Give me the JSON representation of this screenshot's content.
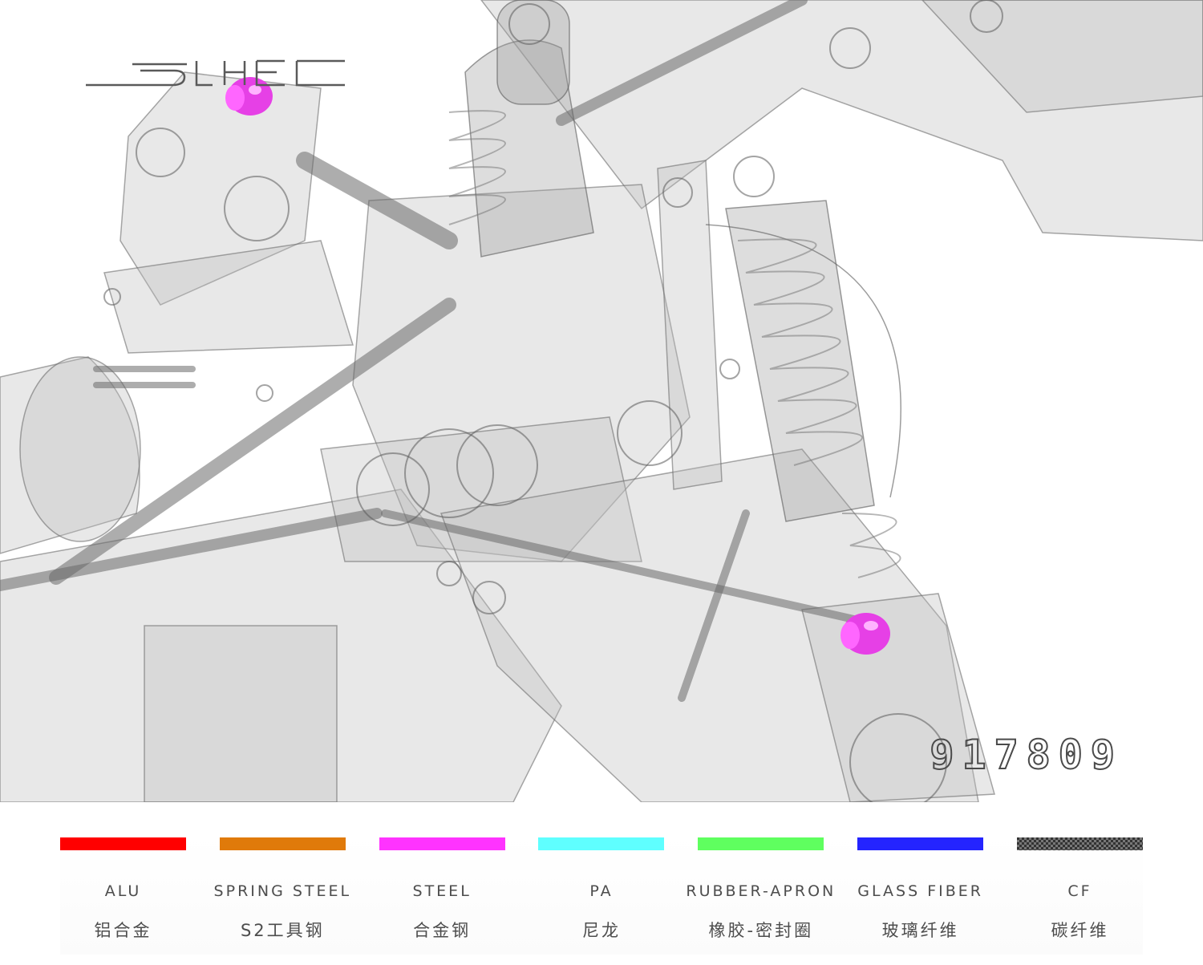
{
  "render": {
    "part_number": "917809",
    "highlight_color": "#ff33ff"
  },
  "legend": {
    "items": [
      {
        "en": "ALU",
        "zh": "铝合金",
        "color": "#ff0000"
      },
      {
        "en": "SPRING STEEL",
        "zh": "S2工具钢",
        "color": "#e07a0a"
      },
      {
        "en": "STEEL",
        "zh": "合金钢",
        "color": "#ff33ff"
      },
      {
        "en": "PA",
        "zh": "尼龙",
        "color": "#5fffff"
      },
      {
        "en": "RUBBER-APRON",
        "zh": "橡胶-密封圈",
        "color": "#5fff5f"
      },
      {
        "en": "GLASS FIBER",
        "zh": "玻璃纤维",
        "color": "#2424ff"
      },
      {
        "en": "CF",
        "zh": "碳纤维",
        "color": "carbon-pattern"
      }
    ]
  }
}
